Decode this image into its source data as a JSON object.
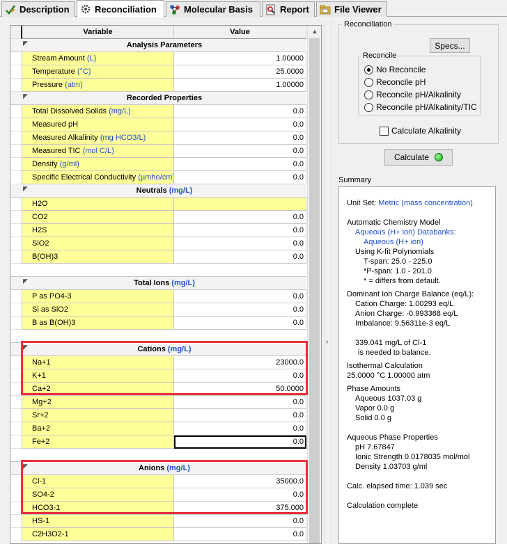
{
  "tabs": [
    {
      "label": "Description",
      "icon": "check-pencil-icon"
    },
    {
      "label": "Reconciliation",
      "icon": "gear-icon"
    },
    {
      "label": "Molecular Basis",
      "icon": "molecule-icon"
    },
    {
      "label": "Report",
      "icon": "report-icon"
    },
    {
      "label": "File Viewer",
      "icon": "folder-icon"
    }
  ],
  "grid": {
    "col_variable": "Variable",
    "col_value": "Value",
    "analysis": {
      "title": "Analysis Parameters",
      "rows": [
        {
          "label": "Stream Amount ",
          "unit": "(L)",
          "value": "1.00000"
        },
        {
          "label": "Temperature ",
          "unit": "(°C)",
          "value": "25.0000"
        },
        {
          "label": "Pressure ",
          "unit": "(atm)",
          "value": "1.00000"
        }
      ]
    },
    "recorded": {
      "title": "Recorded Properties",
      "rows": [
        {
          "label": "Total Dissolved Solids ",
          "unit": "(mg/L)",
          "value": "0.0"
        },
        {
          "label": "Measured pH",
          "unit": "",
          "value": "0.0"
        },
        {
          "label": "Measured Alkalinity ",
          "unit": "(mg HCO3/L)",
          "value": "0.0"
        },
        {
          "label": "Measured TIC ",
          "unit": "(mol C/L)",
          "value": "0.0"
        },
        {
          "label": "Density ",
          "unit": "(g/ml)",
          "value": "0.0"
        },
        {
          "label": "Specific Electrical Conductivity ",
          "unit": "(µmho/cm)",
          "value": "0.0"
        }
      ]
    },
    "neutrals": {
      "title": "Neutrals ",
      "unit": "(mg/L)",
      "rows": [
        {
          "label": "H2O",
          "value": ""
        },
        {
          "label": "CO2",
          "value": "0.0"
        },
        {
          "label": "H2S",
          "value": "0.0"
        },
        {
          "label": "SiO2",
          "value": "0.0"
        },
        {
          "label": "B(OH)3",
          "value": "0.0"
        }
      ]
    },
    "total_ions": {
      "title": "Total Ions ",
      "unit": "(mg/L)",
      "rows": [
        {
          "label": "P as PO4-3",
          "value": "0.0"
        },
        {
          "label": "Si as SiO2",
          "value": "0.0"
        },
        {
          "label": "B as B(OH)3",
          "value": "0.0"
        }
      ]
    },
    "cations": {
      "title": "Cations ",
      "unit": "(mg/L)",
      "rows": [
        {
          "label": "Na+1",
          "value": "23000.0"
        },
        {
          "label": "K+1",
          "value": "0.0"
        },
        {
          "label": "Ca+2",
          "value": "50.0000"
        },
        {
          "label": "Mg+2",
          "value": "0.0"
        },
        {
          "label": "Sr+2",
          "value": "0.0"
        },
        {
          "label": "Ba+2",
          "value": "0.0"
        },
        {
          "label": "Fe+2",
          "value": "0.0"
        }
      ]
    },
    "anions": {
      "title": "Anions ",
      "unit": "(mg/L)",
      "rows": [
        {
          "label": "Cl-1",
          "value": "35000.0"
        },
        {
          "label": "SO4-2",
          "value": "0.0"
        },
        {
          "label": "HCO3-1",
          "value": "375.000"
        },
        {
          "label": "HS-1",
          "value": "0.0"
        },
        {
          "label": "C2H3O2-1",
          "value": "0.0"
        }
      ]
    }
  },
  "reconciliation": {
    "group_title": "Reconciliation",
    "specs_button": "Specs...",
    "reconcile_title": "Reconcile",
    "options": [
      "No Reconcile",
      "Reconcile pH",
      "Reconcile pH/Alkalinity",
      "Reconcile pH/Alkalinity/TIC"
    ],
    "selected_index": 0,
    "calc_alkalinity": "Calculate Alkalinity",
    "calc_alkalinity_checked": false,
    "calculate_button": "Calculate"
  },
  "summary": {
    "title": "Summary",
    "unit_set_label": "Unit Set: ",
    "unit_set_value": "Metric (mass concentration)",
    "model_title": "Automatic Chemistry Model",
    "databanks": "Aqueous (H+ ion) Databanks:",
    "databank_item": "Aqueous (H+ ion)",
    "kfit": "Using K-fit Polynomials",
    "tspan": "T-span: 25.0 - 225.0",
    "pspan": "*P-span: 1.0 - 201.0",
    "differs": "* = differs from default.",
    "dominant": "Dominant Ion Charge Balance (eq/L):",
    "cation_charge": "Cation Charge:    1.00293 eq/L",
    "anion_charge": "Anion Charge:    -0.993368 eq/L",
    "imbalance": "Imbalance:     9.56311e-3 eq/L",
    "balance_1": "339.041 mg/L of Cl-1",
    "balance_2": "is needed to balance.",
    "iso_1": "Isothermal Calculation",
    "iso_2": "25.0000 °C 1.00000 atm",
    "phase_title": "Phase Amounts",
    "aqueous": "Aqueous    1037.03 g",
    "vapor": "Vapor      0.0 g",
    "solid": "Solid          0.0 g",
    "aq_props": "Aqueous Phase Properties",
    "ph": "pH           7.67847",
    "ionic": "Ionic Strength   0.0178035 mol/mol",
    "density": "Density     1.03703 g/ml",
    "elapsed": "Calc. elapsed time: 1.039 sec",
    "complete": "Calculation complete"
  },
  "colors": {
    "highlight_box": "#e8323c",
    "input_cell": "#ffff99",
    "unit_text": "#1f4fd0"
  }
}
